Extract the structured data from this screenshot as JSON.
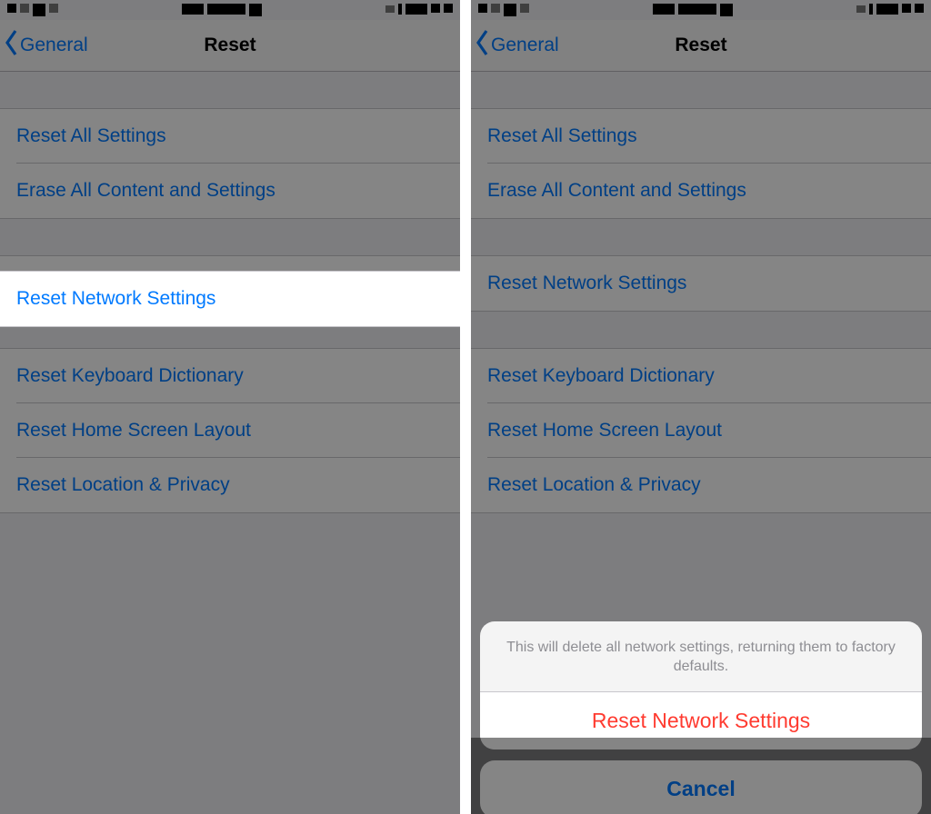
{
  "nav": {
    "back_label": "General",
    "title": "Reset"
  },
  "options": {
    "reset_all": "Reset All Settings",
    "erase_all": "Erase All Content and Settings",
    "reset_network": "Reset Network Settings",
    "reset_keyboard": "Reset Keyboard Dictionary",
    "reset_home": "Reset Home Screen Layout",
    "reset_location": "Reset Location & Privacy"
  },
  "sheet": {
    "message": "This will delete all network settings, returning them to factory defaults.",
    "confirm": "Reset Network Settings",
    "cancel": "Cancel"
  }
}
